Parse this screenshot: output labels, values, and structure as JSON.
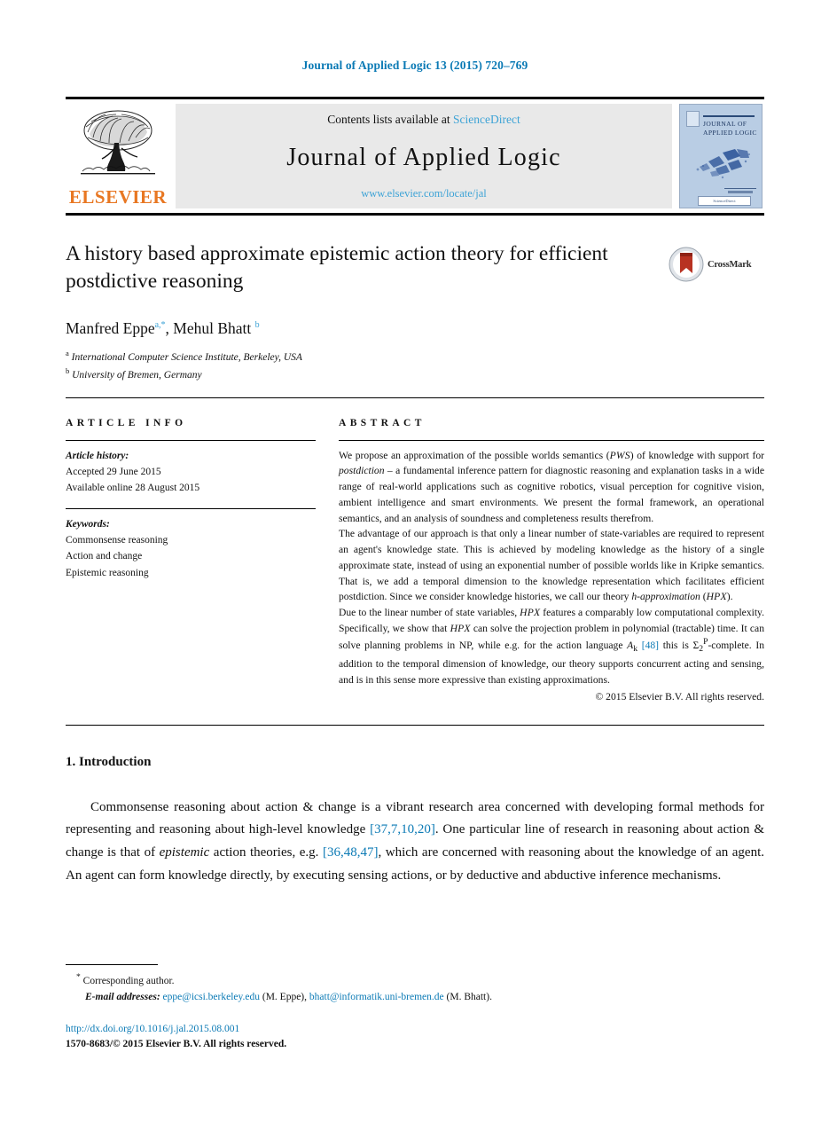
{
  "running_head": "Journal of Applied Logic 13 (2015) 720–769",
  "masthead": {
    "publisher_name": "ELSEVIER",
    "contents_prefix": "Contents lists available at",
    "contents_link": "ScienceDirect",
    "journal_name": "Journal of Applied Logic",
    "journal_url": "www.elsevier.com/locate/jal",
    "cover_title": "JOURNAL OF APPLIED LOGIC"
  },
  "article": {
    "title": "A history based approximate epistemic action theory for efficient postdictive reasoning",
    "crossmark_label": "CrossMark",
    "authors_html": "Manfred Eppe<sup class=\"a\">a</sup><sup class=\"star\">,*</sup>, Mehul Bhatt <sup class=\"b\">b</sup>",
    "affiliations": [
      {
        "marker": "a",
        "text": "International Computer Science Institute, Berkeley, USA"
      },
      {
        "marker": "b",
        "text": "University of Bremen, Germany"
      }
    ]
  },
  "article_info": {
    "heading": "ARTICLE INFO",
    "history_label": "Article history:",
    "history": [
      "Accepted 29 June 2015",
      "Available online 28 August 2015"
    ],
    "keywords_label": "Keywords:",
    "keywords": [
      "Commonsense reasoning",
      "Action and change",
      "Epistemic reasoning"
    ]
  },
  "abstract": {
    "heading": "ABSTRACT",
    "paragraph1": "We propose an approximation of the possible worlds semantics (PWS) of knowledge with support for postdiction – a fundamental inference pattern for diagnostic reasoning and explanation tasks in a wide range of real-world applications such as cognitive robotics, visual perception for cognitive vision, ambient intelligence and smart environments. We present the formal framework, an operational semantics, and an analysis of soundness and completeness results therefrom.",
    "paragraph2": "The advantage of our approach is that only a linear number of state-variables are required to represent an agent's knowledge state. This is achieved by modeling knowledge as the history of a single approximate state, instead of using an exponential number of possible worlds like in Kripke semantics. That is, we add a temporal dimension to the knowledge representation which facilitates efficient postdiction. Since we consider knowledge histories, we call our theory h-approximation (HPX).",
    "paragraph3": "Due to the linear number of state variables, HPX features a comparably low computational complexity. Specifically, we show that HPX can solve the projection problem in polynomial (tractable) time. It can solve planning problems in NP, while e.g. for the action language Ak [48] this is Σ2P-complete. In addition to the temporal dimension of knowledge, our theory supports concurrent acting and sensing, and is in this sense more expressive than existing approximations.",
    "copyright": "© 2015 Elsevier B.V. All rights reserved."
  },
  "body": {
    "section_number": "1.",
    "section_title": "Introduction",
    "paragraph1": "Commonsense reasoning about action & change is a vibrant research area concerned with developing formal methods for representing and reasoning about high-level knowledge [37,7,10,20]. One particular line of research in reasoning about action & change is that of epistemic action theories, e.g. [36,48,47], which are concerned with reasoning about the knowledge of an agent. An agent can form knowledge directly, by executing sensing actions, or by deductive and abductive inference mechanisms.",
    "citation1": "[37,7,10,20]",
    "citation2": "[36,48,47]"
  },
  "footnotes": {
    "corresponding_marker": "*",
    "corresponding_text": "Corresponding author.",
    "email_label": "E-mail addresses:",
    "emails": [
      {
        "address": "eppe@icsi.berkeley.edu",
        "name": "(M. Eppe),"
      },
      {
        "address": "bhatt@informatik.uni-bremen.de",
        "name": "(M. Bhatt)."
      }
    ],
    "doi": "http://dx.doi.org/10.1016/j.jal.2015.08.001",
    "issn_line": "1570-8683/© 2015 Elsevier B.V. All rights reserved."
  },
  "colors": {
    "link_blue": "#0b7ab5",
    "light_blue": "#3da3d6",
    "elsevier_orange": "#e87722",
    "band_gray": "#e9e9e9"
  }
}
